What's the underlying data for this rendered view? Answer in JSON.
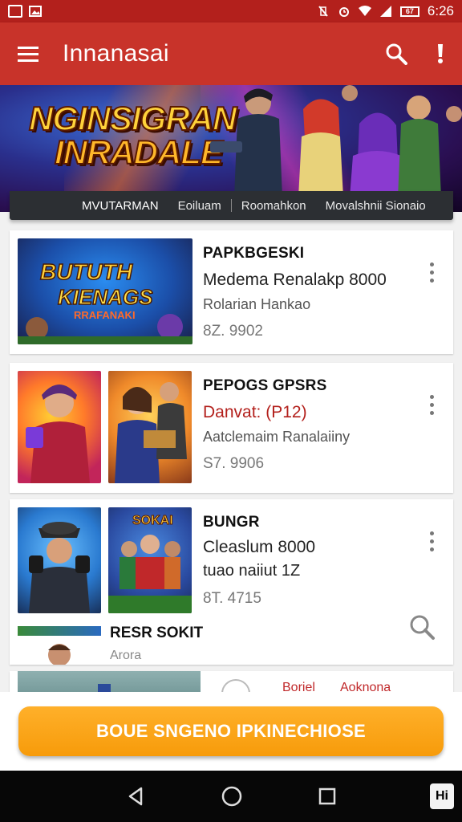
{
  "status_bar": {
    "time": "6:26",
    "icons": [
      "notification-icon",
      "vibrate-icon",
      "alarm-icon",
      "wifi-icon",
      "signal-icon",
      "battery-icon"
    ],
    "battery_label": "67"
  },
  "app_bar": {
    "title": "Innanasai",
    "menu_icon": "hamburger-menu-icon",
    "search_icon": "search-icon",
    "more_icon": "exclamation-icon"
  },
  "hero": {
    "logo_line1": "NGINSIGRAN",
    "logo_line2": "INRADALE"
  },
  "tabs": [
    {
      "label": "MVUTARMAN"
    },
    {
      "label": "Eoiluam"
    },
    {
      "label": "Roomahkon"
    },
    {
      "label": "Movalshnii Sionaio"
    }
  ],
  "cards": [
    {
      "title": "PAPKBGESKI",
      "subtitle": "Medema Renalakp 8000",
      "line3": "Rolarian Hankao",
      "price": "8Z. 9902",
      "thumb_text1": "BUTUTH",
      "thumb_text2": "KIENAGS",
      "thumb_text3": "RRAFANAKI"
    },
    {
      "title": "PEPOGS GPSRS",
      "subtitle": "Danvat: (P12)",
      "line3": "Aatclemaim Ranalaiiny",
      "price": "S7. 9906"
    },
    {
      "title": "BUNGR",
      "subtitle": "Cleaslum 8000",
      "line3": "tuao naiiut 1Z",
      "price": "8T. 4715",
      "thumb_text": "SOKAI"
    }
  ],
  "partial_row": {
    "title": "RESR SOKIT",
    "subtitle": "Arora"
  },
  "bottom_row": {
    "label_a": "Boriel",
    "label_b": "Aoknona"
  },
  "cta": {
    "label": "BOUE SNGENO IPKINECHIOSE"
  },
  "nav_bar": {
    "back_icon": "back-triangle-icon",
    "home_icon": "home-circle-icon",
    "recents_icon": "recents-square-icon",
    "key_hint": "Hi"
  },
  "colors": {
    "primary": "#c8332a",
    "status_bar": "#b3201c",
    "accent": "#f7a21a",
    "tab_strip": "#2c2f33"
  }
}
